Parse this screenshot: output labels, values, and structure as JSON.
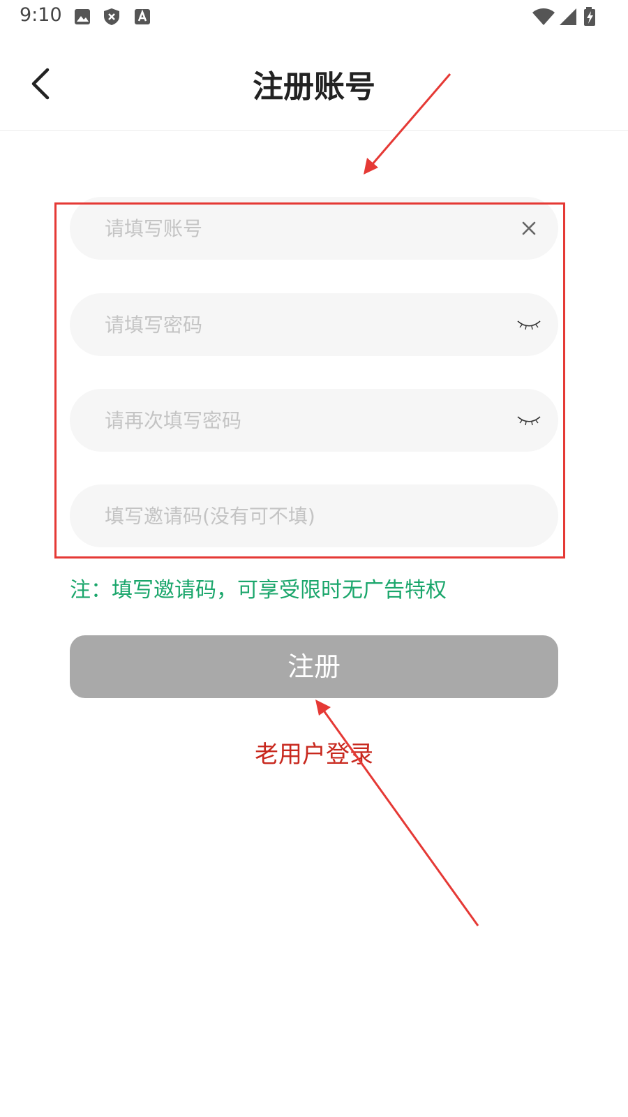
{
  "status_bar": {
    "time": "9:10",
    "icons": [
      "image-icon",
      "shield-icon",
      "text-a-icon"
    ],
    "right_icons": [
      "wifi-icon",
      "signal-icon",
      "battery-charging-icon"
    ]
  },
  "header": {
    "title": "注册账号",
    "back_icon": "chevron-left-icon"
  },
  "form": {
    "account": {
      "placeholder": "请填写账号",
      "value": "",
      "icon": "close-icon"
    },
    "password": {
      "placeholder": "请填写密码",
      "value": "",
      "icon": "eye-closed-icon"
    },
    "confirm_password": {
      "placeholder": "请再次填写密码",
      "value": "",
      "icon": "eye-closed-icon"
    },
    "invite_code": {
      "placeholder": "填写邀请码(没有可不填)",
      "value": ""
    }
  },
  "note": "注：填写邀请码，可享受限时无广告特权",
  "register_button": {
    "label": "注册",
    "color": "#a9a9a9"
  },
  "login_link": {
    "label": "老用户登录",
    "color": "#c8281e"
  },
  "colors": {
    "note": "#1aa66b",
    "annotation": "#e53935",
    "field_bg": "#f6f6f6"
  }
}
